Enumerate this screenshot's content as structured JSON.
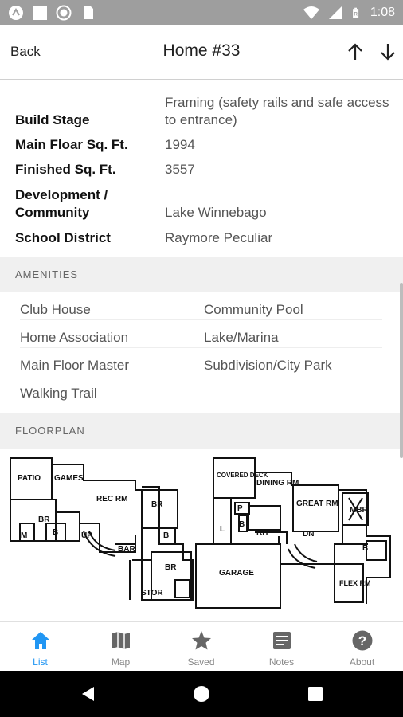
{
  "status_bar": {
    "time": "1:08",
    "bar_color": "#9e9e9e"
  },
  "header": {
    "back_label": "Back",
    "title": "Home #33"
  },
  "details": [
    {
      "label": "Build Stage",
      "value": "Framing (safety rails and safe access to entrance)"
    },
    {
      "label": "Main Floar Sq. Ft.",
      "value": "1994"
    },
    {
      "label": "Finished Sq. Ft.",
      "value": "3557"
    },
    {
      "label": "Development / Community",
      "value": "Lake Winnebago"
    },
    {
      "label": "School District",
      "value": "Raymore Peculiar"
    }
  ],
  "amenities": {
    "header": "AMENITIES",
    "items": [
      [
        "Club House",
        "Community Pool"
      ],
      [
        "Home Association",
        "Lake/Marina"
      ],
      [
        "Main Floor Master",
        "Subdivision/City Park"
      ],
      [
        "Walking Trail",
        ""
      ]
    ]
  },
  "floorplan": {
    "header": "FLOORPLAN",
    "lower_rooms": [
      "PATIO",
      "GAMES",
      "REC RM",
      "BR",
      "BR",
      "M",
      "B",
      "UP",
      "BAR",
      "BR",
      "B",
      "STOR"
    ],
    "main_rooms": [
      "COVERED DECK",
      "DINING RM",
      "GREAT RM",
      "MBR",
      "P",
      "L",
      "B",
      "KIT",
      "DN",
      "B",
      "GARAGE",
      "FLEX RM"
    ]
  },
  "tabs": [
    {
      "label": "List",
      "icon": "home-icon",
      "active": true
    },
    {
      "label": "Map",
      "icon": "map-icon",
      "active": false
    },
    {
      "label": "Saved",
      "icon": "star-icon",
      "active": false
    },
    {
      "label": "Notes",
      "icon": "notes-icon",
      "active": false
    },
    {
      "label": "About",
      "icon": "help-icon",
      "active": false
    }
  ],
  "colors": {
    "accent": "#2196f3",
    "section_bg": "#f0f0f0",
    "label": "#111111",
    "value": "#555555"
  }
}
